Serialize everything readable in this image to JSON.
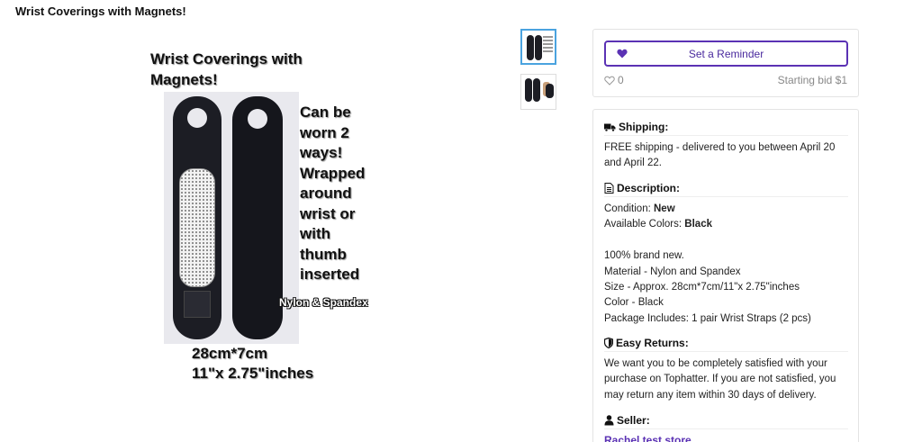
{
  "page": {
    "title": "Wrist Coverings with Magnets!"
  },
  "product_image": {
    "title_line1": "Wrist Coverings with",
    "title_line2": "Magnets!",
    "side_text": [
      "Can be",
      "worn 2",
      "ways!",
      "Wrapped",
      "around",
      "wrist or",
      "with",
      "thumb",
      "inserted"
    ],
    "material": "Nylon & Spandex",
    "size_line1": "28cm*7cm",
    "size_line2": "11\"x 2.75\"inches"
  },
  "thumbnails": [
    {
      "name": "thumbnail-1",
      "selected": true
    },
    {
      "name": "thumbnail-2",
      "selected": false
    }
  ],
  "bid": {
    "reminder_label": "Set a Reminder",
    "reminder_icon": "heart-icon",
    "like_count": "0",
    "like_icon": "heart-outline-icon",
    "starting_bid": "Starting bid $1",
    "accent_color": "#5b32b4"
  },
  "shipping": {
    "heading": "Shipping:",
    "icon": "truck-icon",
    "text": "FREE shipping - delivered to you between April 20 and April 22."
  },
  "description": {
    "heading": "Description:",
    "icon": "document-icon",
    "condition_label": "Condition:",
    "condition_value": "New",
    "colors_label": "Available Colors:",
    "colors_value": "Black",
    "lines": [
      "100% brand new.",
      "Material - Nylon and Spandex",
      "Size - Approx. 28cm*7cm/11\"x 2.75\"inches",
      "Color - Black",
      "Package Includes: 1 pair Wrist Straps (2 pcs)"
    ]
  },
  "returns": {
    "heading": "Easy Returns:",
    "icon": "shield-icon",
    "text": "We want you to be completely satisfied with your purchase on Tophatter. If you are not satisfied, you may return any item within 30 days of delivery."
  },
  "seller": {
    "heading": "Seller:",
    "icon": "user-icon",
    "name": "Rachel test store"
  }
}
